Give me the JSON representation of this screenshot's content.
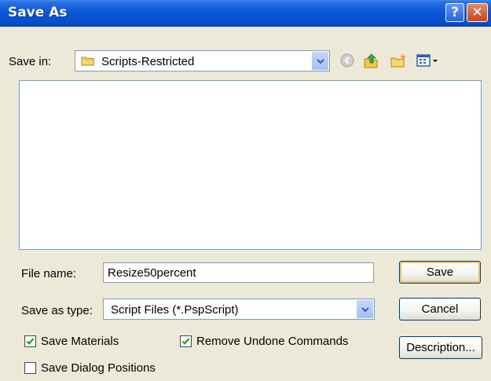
{
  "window": {
    "title": "Save As",
    "help_label": "?",
    "close_label": "✕"
  },
  "save_in": {
    "label": "Save in:",
    "value": "Scripts-Restricted"
  },
  "toolbar_icons": [
    "back-icon",
    "up-folder-icon",
    "new-folder-icon",
    "views-menu-icon"
  ],
  "file_name": {
    "label": "File name:",
    "value": "Resize50percent"
  },
  "save_as_type": {
    "label": "Save as type:",
    "value": "Script Files (*.PspScript)"
  },
  "buttons": {
    "save": "Save",
    "cancel": "Cancel",
    "description": "Description..."
  },
  "options": {
    "save_materials": {
      "label": "Save Materials",
      "checked": true
    },
    "remove_undone": {
      "label": "Remove Undone Commands",
      "checked": true
    },
    "save_dialog_positions": {
      "label": "Save Dialog Positions",
      "checked": false
    }
  },
  "colors": {
    "titlebar": "#0a58d8",
    "dialog_bg": "#ece9d8",
    "check": "#21a121"
  }
}
